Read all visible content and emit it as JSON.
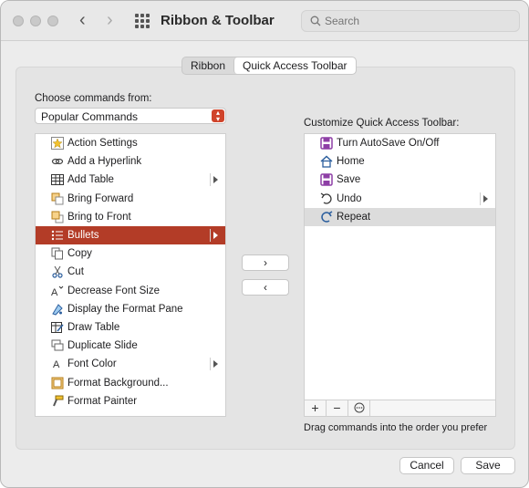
{
  "window": {
    "title": "Ribbon & Toolbar",
    "search_placeholder": "Search"
  },
  "tabs": [
    {
      "label": "Ribbon",
      "active": false
    },
    {
      "label": "Quick Access Toolbar",
      "active": true
    }
  ],
  "left": {
    "choose_label": "Choose commands from:",
    "popup_value": "Popular Commands",
    "commands": [
      {
        "label": "Action Settings",
        "icon": "action-settings-icon"
      },
      {
        "label": "Add a Hyperlink",
        "icon": "hyperlink-icon"
      },
      {
        "label": "Add Table",
        "icon": "table-icon",
        "submenu": true
      },
      {
        "label": "Bring Forward",
        "icon": "bring-forward-icon"
      },
      {
        "label": "Bring to Front",
        "icon": "bring-to-front-icon"
      },
      {
        "label": "Bullets",
        "icon": "bullets-icon",
        "submenu": true,
        "selected": true
      },
      {
        "label": "Copy",
        "icon": "copy-icon"
      },
      {
        "label": "Cut",
        "icon": "scissors-icon"
      },
      {
        "label": "Decrease Font Size",
        "icon": "decrease-font-icon"
      },
      {
        "label": "Display the Format Pane",
        "icon": "format-pane-icon"
      },
      {
        "label": "Draw Table",
        "icon": "draw-table-icon"
      },
      {
        "label": "Duplicate Slide",
        "icon": "duplicate-slide-icon"
      },
      {
        "label": "Font Color",
        "icon": "font-color-icon",
        "submenu": true
      },
      {
        "label": "Format Background...",
        "icon": "format-background-icon"
      },
      {
        "label": "Format Painter",
        "icon": "format-painter-icon"
      }
    ]
  },
  "right": {
    "customize_label": "Customize Quick Access Toolbar:",
    "items": [
      {
        "label": "Turn AutoSave On/Off",
        "icon": "autosave-icon"
      },
      {
        "label": "Home",
        "icon": "home-icon"
      },
      {
        "label": "Save",
        "icon": "save-icon"
      },
      {
        "label": "Undo",
        "icon": "undo-icon",
        "submenu": true
      },
      {
        "label": "Repeat",
        "icon": "repeat-icon",
        "selected": true
      }
    ],
    "bottom_buttons": {
      "add": "+",
      "remove": "−",
      "more": "⋯"
    },
    "hint": "Drag commands into the order you prefer"
  },
  "transfer": {
    "add": "›",
    "remove": "‹"
  },
  "footer": {
    "cancel": "Cancel",
    "save": "Save"
  },
  "colors": {
    "accent": "#b33c27",
    "selection_gray": "#dcdcdc",
    "save_purple": "#8e3fa6",
    "home_blue": "#2c5f9e"
  }
}
